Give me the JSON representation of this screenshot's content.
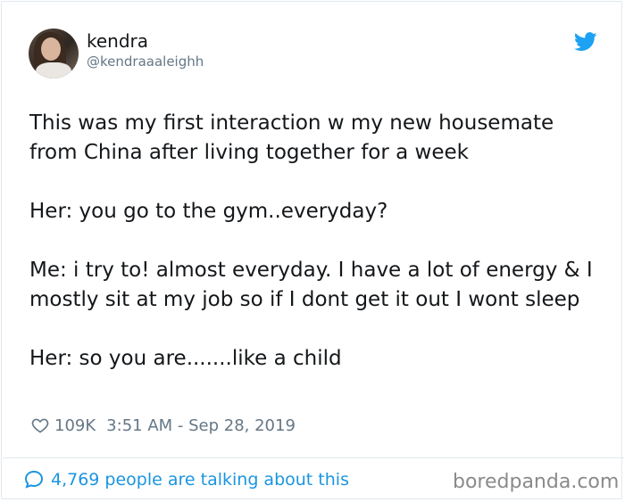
{
  "author": {
    "name": "kendra",
    "handle": "@kendraaaleighh"
  },
  "tweet": {
    "paragraphs": [
      "This was my first interaction w my new housemate from China after living together for a week",
      "Her: you go to the gym..everyday?",
      "Me: i try to! almost everyday. I have a lot of energy & I mostly sit at my job so if I dont get it out I wont sleep",
      "Her: so you are.......like a child"
    ]
  },
  "meta": {
    "likes": "109K",
    "timestamp": "3:51 AM - Sep 28, 2019"
  },
  "footer": {
    "talking_text": "4,769 people are talking about this",
    "watermark": "boredpanda.com"
  },
  "icons": {
    "brand": "twitter-bird-icon",
    "like": "heart-icon",
    "conversation": "speech-bubble-icon"
  },
  "colors": {
    "twitter_blue": "#1da1f2",
    "link_blue": "#1b95e0",
    "secondary_text": "#657786",
    "primary_text": "#14171a"
  }
}
